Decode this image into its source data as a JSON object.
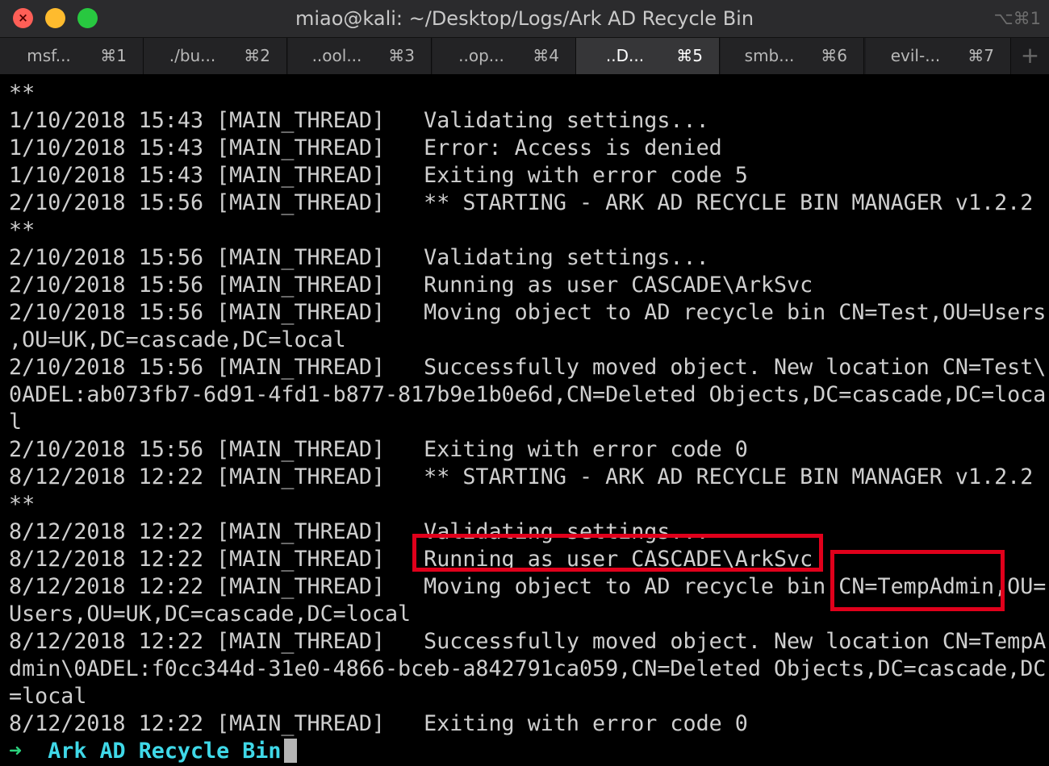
{
  "window": {
    "title": "miao@kali: ~/Desktop/Logs/Ark AD Recycle Bin",
    "title_shortcut": "⌥⌘1",
    "close_glyph": "×"
  },
  "tabs": [
    {
      "label": "msf...",
      "shortcut": "⌘1"
    },
    {
      "label": "./bu...",
      "shortcut": "⌘2"
    },
    {
      "label": "..ool...",
      "shortcut": "⌘3"
    },
    {
      "label": "..op...",
      "shortcut": "⌘4"
    },
    {
      "label": "..D...",
      "shortcut": "⌘5"
    },
    {
      "label": "smb...",
      "shortcut": "⌘6"
    },
    {
      "label": "evil-...",
      "shortcut": "⌘7"
    }
  ],
  "tab_add_label": "+",
  "lines": [
    "**",
    "1/10/2018 15:43 [MAIN_THREAD]   Validating settings...",
    "1/10/2018 15:43 [MAIN_THREAD]   Error: Access is denied",
    "1/10/2018 15:43 [MAIN_THREAD]   Exiting with error code 5",
    "2/10/2018 15:56 [MAIN_THREAD]   ** STARTING - ARK AD RECYCLE BIN MANAGER v1.2.2",
    "**",
    "2/10/2018 15:56 [MAIN_THREAD]   Validating settings...",
    "2/10/2018 15:56 [MAIN_THREAD]   Running as user CASCADE\\ArkSvc",
    "2/10/2018 15:56 [MAIN_THREAD]   Moving object to AD recycle bin CN=Test,OU=Users",
    ",OU=UK,DC=cascade,DC=local",
    "2/10/2018 15:56 [MAIN_THREAD]   Successfully moved object. New location CN=Test\\",
    "0ADEL:ab073fb7-6d91-4fd1-b877-817b9e1b0e6d,CN=Deleted Objects,DC=cascade,DC=loca",
    "l",
    "2/10/2018 15:56 [MAIN_THREAD]   Exiting with error code 0",
    "8/12/2018 12:22 [MAIN_THREAD]   ** STARTING - ARK AD RECYCLE BIN MANAGER v1.2.2",
    "**",
    "8/12/2018 12:22 [MAIN_THREAD]   Validating settings...",
    "8/12/2018 12:22 [MAIN_THREAD]   Running as user CASCADE\\ArkSvc",
    "8/12/2018 12:22 [MAIN_THREAD]   Moving object to AD recycle bin CN=TempAdmin,OU=",
    "Users,OU=UK,DC=cascade,DC=local",
    "8/12/2018 12:22 [MAIN_THREAD]   Successfully moved object. New location CN=TempA",
    "dmin\\0ADEL:f0cc344d-31e0-4866-bceb-a842791ca059,CN=Deleted Objects,DC=cascade,DC",
    "=local",
    "8/12/2018 12:22 [MAIN_THREAD]   Exiting with error code 0"
  ],
  "prompt": {
    "arrow": "➜",
    "cwd": "Ark AD Recycle Bin"
  },
  "colors": {
    "background": "#000000",
    "text": "#cfcfcf",
    "prompt_arrow": "#2bd17c",
    "prompt_cwd": "#3fd8e8",
    "highlight_box": "#e0001b"
  }
}
